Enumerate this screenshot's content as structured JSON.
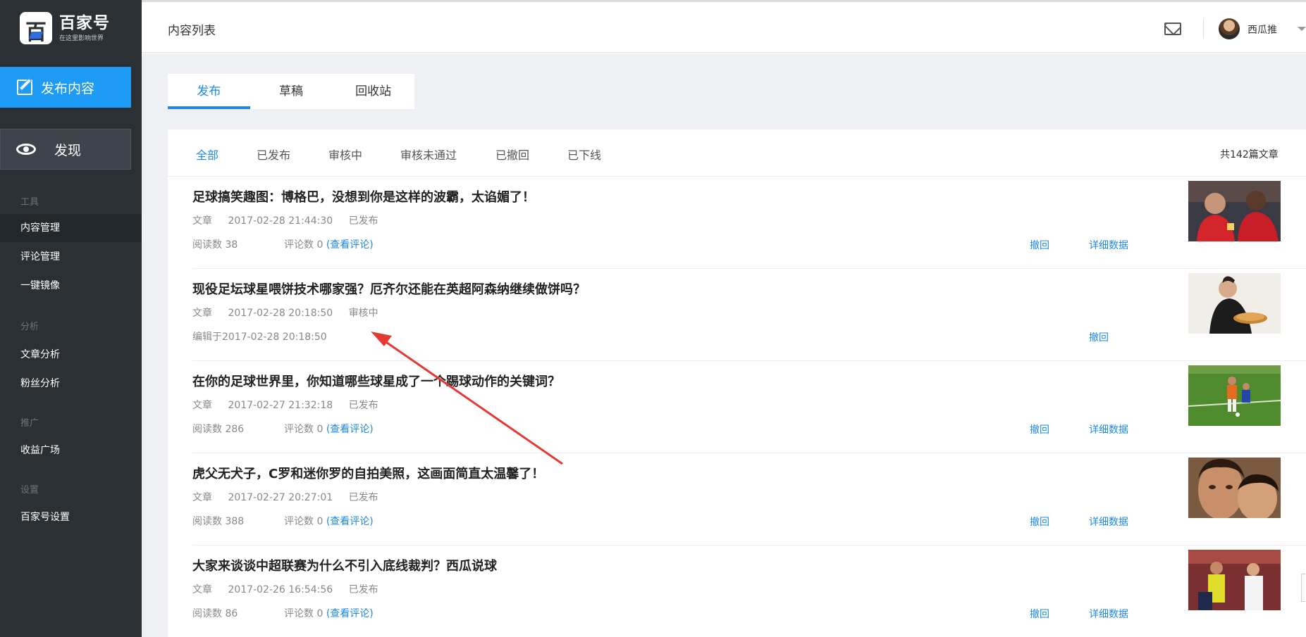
{
  "brand": {
    "name": "百家号",
    "slogan": "在这里影响世界",
    "glyph": "百"
  },
  "sidebar": {
    "publish": "发布内容",
    "discover": "发现",
    "sections": [
      {
        "title": "工具",
        "items": [
          "内容管理",
          "评论管理",
          "一键镜像"
        ]
      },
      {
        "title": "分析",
        "items": [
          "文章分析",
          "粉丝分析"
        ]
      },
      {
        "title": "推广",
        "items": [
          "收益广场"
        ]
      },
      {
        "title": "设置",
        "items": [
          "百家号设置"
        ]
      }
    ],
    "active_item": "内容管理"
  },
  "header": {
    "title": "内容列表",
    "username": "西瓜推"
  },
  "tabs": [
    "发布",
    "草稿",
    "回收站"
  ],
  "active_tab": "发布",
  "filters": [
    "全部",
    "已发布",
    "审核中",
    "审核未通过",
    "已撤回",
    "已下线"
  ],
  "active_filter": "全部",
  "total": "共142篇文章",
  "labels": {
    "reads": "阅读数",
    "comments": "评论数",
    "view_comments": "(查看评论)",
    "withdraw": "撤回",
    "details": "详细数据"
  },
  "articles": [
    {
      "title": "足球搞笑趣图：博格巴，没想到你是这样的波霸，太谄媚了！",
      "type": "文章",
      "time": "2017-02-28 21:44:30",
      "status": "已发布",
      "reads": "38",
      "comments": "0"
    },
    {
      "title": "现役足坛球星喂饼技术哪家强？厄齐尔还能在英超阿森纳继续做饼吗？",
      "type": "文章",
      "time": "2017-02-28 20:18:50",
      "status": "审核中",
      "edited": "编辑于2017-02-28 20:18:50"
    },
    {
      "title": "在你的足球世界里，你知道哪些球星成了一个踢球动作的关键词？",
      "type": "文章",
      "time": "2017-02-27 21:32:18",
      "status": "已发布",
      "reads": "286",
      "comments": "0"
    },
    {
      "title": "虎父无犬子，C罗和迷你罗的自拍美照，这画面简直太温馨了！",
      "type": "文章",
      "time": "2017-02-27 20:27:01",
      "status": "已发布",
      "reads": "388",
      "comments": "0"
    },
    {
      "title": "大家来谈谈中超联赛为什么不引入底线裁判？西瓜说球",
      "type": "文章",
      "time": "2017-02-26 16:54:56",
      "status": "已发布",
      "reads": "86",
      "comments": "0"
    }
  ],
  "colors": {
    "accent": "#1e89e2",
    "sidebar": "#2b3035",
    "publish_button": "#1e9cf5",
    "annotation_arrow": "#e53935"
  }
}
